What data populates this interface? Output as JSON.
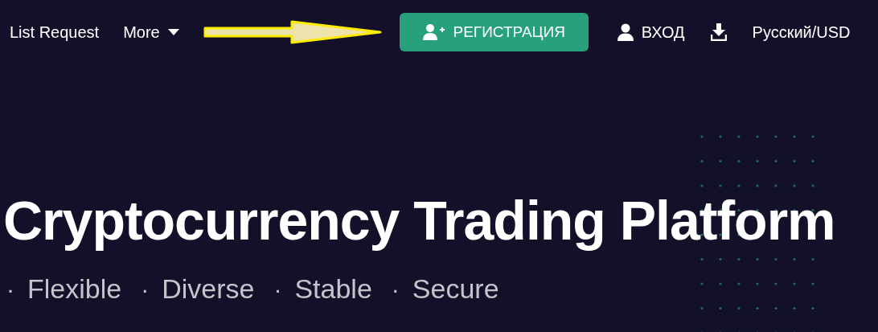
{
  "nav": {
    "links": [
      {
        "label": "List Request",
        "kind": "link"
      },
      {
        "label": "More",
        "kind": "dropdown"
      }
    ],
    "register_button": "РЕГИСТРАЦИЯ",
    "login": "ВХОД",
    "language": "Русский/USD"
  },
  "hero": {
    "title": "Cryptocurrency Trading Platform",
    "features": [
      {
        "bullet": "·",
        "label": "Flexible"
      },
      {
        "bullet": "·",
        "label": "Diverse"
      },
      {
        "bullet": "·",
        "label": "Stable"
      },
      {
        "bullet": "·",
        "label": "Secure"
      }
    ]
  }
}
